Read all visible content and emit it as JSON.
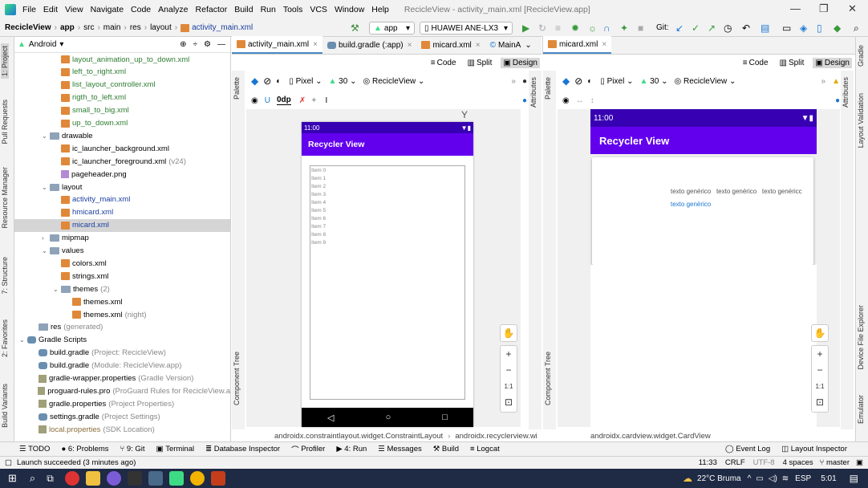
{
  "menu": {
    "items": [
      "File",
      "Edit",
      "View",
      "Navigate",
      "Code",
      "Analyze",
      "Refactor",
      "Build",
      "Run",
      "Tools",
      "VCS",
      "Window",
      "Help"
    ],
    "window_title": "RecicleView - activity_main.xml [RecicleView.app]"
  },
  "nav": {
    "crumbs": [
      "RecicleView",
      "app",
      "src",
      "main",
      "res",
      "layout",
      "activity_main.xml"
    ],
    "run_config": "app",
    "device": "HUAWEI ANE-LX3",
    "git_label": "Git:"
  },
  "left_strip": [
    "1: Project",
    "Pull Requests",
    "Resource Manager",
    "7: Structure",
    "2: Favorites",
    "Build Variants"
  ],
  "right_strip": [
    "Gradle",
    "Layout Validation",
    "Device File Explorer",
    "Emulator"
  ],
  "project": {
    "view_label": "Android",
    "tree": [
      {
        "label": "layout_animation_up_to_down.xml",
        "kind": "xml",
        "color": "green",
        "indent": 3
      },
      {
        "label": "left_to_right.xml",
        "kind": "xml",
        "color": "green",
        "indent": 3
      },
      {
        "label": "list_layout_controller.xml",
        "kind": "xml",
        "color": "green",
        "indent": 3
      },
      {
        "label": "rigth_to_left.xml",
        "kind": "xml",
        "color": "green",
        "indent": 3
      },
      {
        "label": "small_to_big.xml",
        "kind": "xml",
        "color": "green",
        "indent": 3
      },
      {
        "label": "up_to_down.xml",
        "kind": "xml",
        "color": "green",
        "indent": 3
      },
      {
        "label": "drawable",
        "kind": "folder",
        "color": "",
        "indent": 2,
        "arrow": "v"
      },
      {
        "label": "ic_launcher_background.xml",
        "kind": "xml",
        "color": "",
        "indent": 3
      },
      {
        "label": "ic_launcher_foreground.xml",
        "kind": "xml",
        "color": "",
        "indent": 3,
        "suffix": "(v24)"
      },
      {
        "label": "pageheader.png",
        "kind": "png",
        "color": "",
        "indent": 3
      },
      {
        "label": "layout",
        "kind": "folder",
        "color": "",
        "indent": 2,
        "arrow": "v"
      },
      {
        "label": "activity_main.xml",
        "kind": "xml",
        "color": "blue",
        "indent": 3
      },
      {
        "label": "hmicard.xml",
        "kind": "xml",
        "color": "blue",
        "indent": 3
      },
      {
        "label": "micard.xml",
        "kind": "xml",
        "color": "blue",
        "indent": 3,
        "selected": true
      },
      {
        "label": "mipmap",
        "kind": "folder",
        "color": "",
        "indent": 2,
        "arrow": ">"
      },
      {
        "label": "values",
        "kind": "folder",
        "color": "",
        "indent": 2,
        "arrow": "v"
      },
      {
        "label": "colors.xml",
        "kind": "xml",
        "color": "",
        "indent": 3
      },
      {
        "label": "strings.xml",
        "kind": "xml",
        "color": "",
        "indent": 3
      },
      {
        "label": "themes",
        "kind": "folder",
        "color": "",
        "indent": 3,
        "arrow": "v",
        "suffix": "(2)"
      },
      {
        "label": "themes.xml",
        "kind": "xml",
        "color": "",
        "indent": 4
      },
      {
        "label": "themes.xml",
        "kind": "xml",
        "color": "",
        "indent": 4,
        "suffix": "(night)"
      },
      {
        "label": "res",
        "kind": "folder",
        "color": "",
        "indent": 1,
        "suffix": "(generated)"
      },
      {
        "label": "Gradle Scripts",
        "kind": "gradle",
        "color": "",
        "indent": 0,
        "arrow": "v"
      },
      {
        "label": "build.gradle",
        "kind": "gradle",
        "color": "",
        "indent": 1,
        "suffix": "(Project: RecicleView)"
      },
      {
        "label": "build.gradle",
        "kind": "gradle",
        "color": "",
        "indent": 1,
        "suffix": "(Module: RecicleView.app)"
      },
      {
        "label": "gradle-wrapper.properties",
        "kind": "props",
        "color": "",
        "indent": 1,
        "suffix": "(Gradle Version)"
      },
      {
        "label": "proguard-rules.pro",
        "kind": "props",
        "color": "",
        "indent": 1,
        "suffix": "(ProGuard Rules for RecicleView.a"
      },
      {
        "label": "gradle.properties",
        "kind": "props",
        "color": "",
        "indent": 1,
        "suffix": "(Project Properties)"
      },
      {
        "label": "settings.gradle",
        "kind": "gradle",
        "color": "",
        "indent": 1,
        "suffix": "(Project Settings)"
      },
      {
        "label": "local.properties",
        "kind": "props",
        "color": "amber",
        "indent": 1,
        "suffix": "(SDK Location)"
      }
    ]
  },
  "editor_left": {
    "tabs": [
      "activity_main.xml",
      "build.gradle (:app)",
      "micard.xml",
      "MainA"
    ],
    "modes": [
      "Code",
      "Split",
      "Design"
    ],
    "toolbar": {
      "pixel": "Pixel",
      "api": "30",
      "theme": "RecicleView",
      "dp": "0dp"
    },
    "phone": {
      "time": "11:00",
      "title": "Recycler View",
      "items": [
        "Item 0",
        "Item 1",
        "Item 2",
        "Item 3",
        "Item 4",
        "Item 5",
        "Item 6",
        "Item 7",
        "Item 8",
        "Item 9"
      ]
    },
    "status": [
      "androidx.constraintlayout.widget.ConstraintLayout",
      "androidx.recyclerview.wi"
    ]
  },
  "editor_right": {
    "tabs": [
      "micard.xml"
    ],
    "modes": [
      "Code",
      "Split",
      "Design"
    ],
    "toolbar": {
      "pixel": "Pixel",
      "api": "30",
      "theme": "RecicleView"
    },
    "phone": {
      "time": "11:00",
      "title": "Recycler View",
      "card_texts": [
        "texto genérico",
        "texto genérico",
        "texto genéricc"
      ],
      "card_link": "texto genérico"
    },
    "status": "androidx.cardview.widget.CardView"
  },
  "side_labels": {
    "palette": "Palette",
    "attributes": "Attributes",
    "component_tree": "Component Tree"
  },
  "zoom": {
    "label": "1:1"
  },
  "toolwindows": [
    "TODO",
    "6: Problems",
    "9: Git",
    "Terminal",
    "Database Inspector",
    "Profiler",
    "4: Run",
    "Messages",
    "Build",
    "Logcat"
  ],
  "toolwindows_right": [
    "Event Log",
    "Layout Inspector"
  ],
  "statusbar": {
    "message": "Launch succeeded (3 minutes ago)",
    "pos": "11:33",
    "crlf": "CRLF",
    "enc": "UTF-8",
    "indent": "4 spaces",
    "branch": "master"
  },
  "taskbar": {
    "weather": "22°C  Bruma",
    "lang": "ESP",
    "time": "5:01"
  },
  "colors": {
    "purple": "#6200ee",
    "purple_dark": "#3700b3",
    "link": "#1976d2"
  }
}
